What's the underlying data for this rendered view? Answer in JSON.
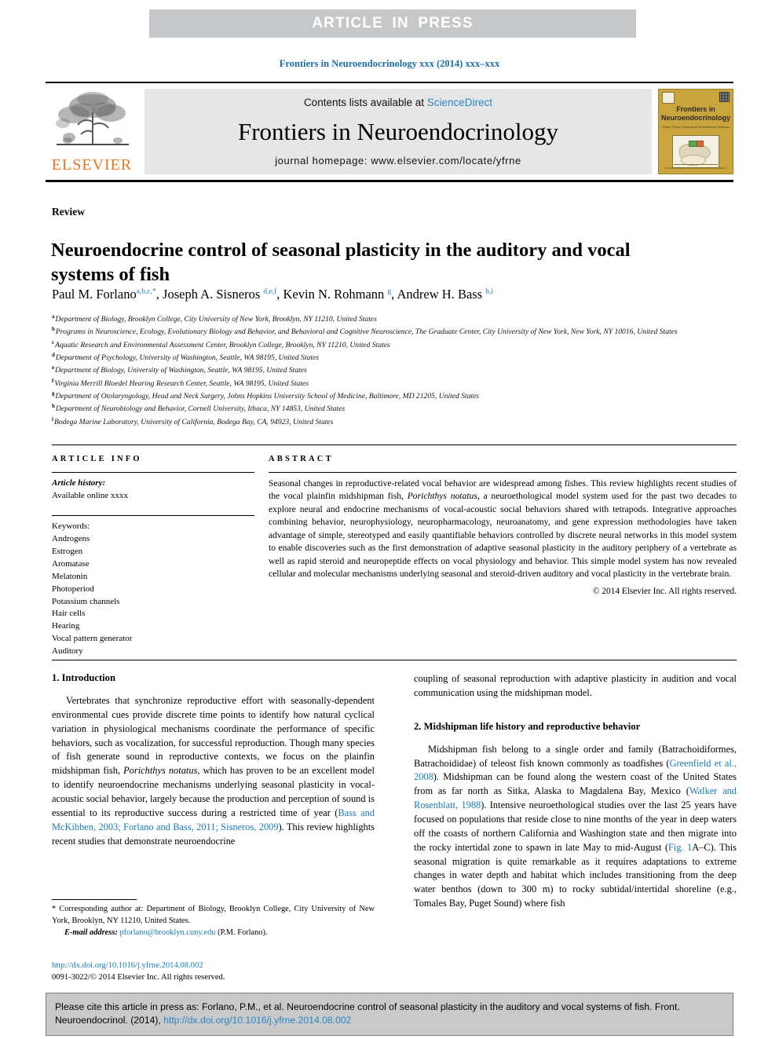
{
  "banner": {
    "text": "ARTICLE IN PRESS",
    "bg_color": "#c6c7c8",
    "text_color": "#ffffff"
  },
  "running_head": "Frontiers in Neuroendocrinology xxx (2014) xxx–xxx",
  "masthead": {
    "publisher_logo_text": "ELSEVIER",
    "publisher_logo_color": "#e87722",
    "contents_prefix": "Contents lists available at ",
    "contents_link": "ScienceDirect",
    "journal_title": "Frontiers in Neuroendocrinology",
    "homepage_line": "journal homepage: www.elsevier.com/locate/yfrne",
    "cover": {
      "title_line1": "Frontiers in",
      "title_line2": "Neuroendocrinology",
      "subtitle": "Volume 35 Issue 2\nInternational Neuroendocrine Federation",
      "bottom_text": "Available online at www.sciencedirect.com\nScienceDirect",
      "bg_color": "#caa43c"
    }
  },
  "article": {
    "type_label": "Review",
    "title": "Neuroendocrine control of seasonal plasticity in the auditory and vocal systems of fish",
    "authors": [
      {
        "name": "Paul M. Forlano",
        "sup": "a,b,c,*"
      },
      {
        "name": "Joseph A. Sisneros",
        "sup": "d,e,f"
      },
      {
        "name": "Kevin N. Rohmann",
        "sup": "g"
      },
      {
        "name": "Andrew H. Bass",
        "sup": "h,i"
      }
    ],
    "affiliations": [
      {
        "marker": "a",
        "text": "Department of Biology, Brooklyn College, City University of New York, Brooklyn, NY 11210, United States"
      },
      {
        "marker": "b",
        "text": "Programs in Neuroscience, Ecology, Evolutionary Biology and Behavior, and Behavioral and Cognitive Neuroscience, The Graduate Center, City University of New York, New York, NY 10016, United States"
      },
      {
        "marker": "c",
        "text": "Aquatic Research and Environmental Assessment Center, Brooklyn College, Brooklyn, NY 11210, United States"
      },
      {
        "marker": "d",
        "text": "Department of Psychology, University of Washington, Seattle, WA 98195, United States"
      },
      {
        "marker": "e",
        "text": "Department of Biology, University of Washington, Seattle, WA 98195, United States"
      },
      {
        "marker": "f",
        "text": "Virginia Merrill Bloedel Hearing Research Center, Seattle, WA 98195, United States"
      },
      {
        "marker": "g",
        "text": "Department of Otolaryngology, Head and Neck Surgery, Johns Hopkins University School of Medicine, Baltimore, MD 21205, United States"
      },
      {
        "marker": "h",
        "text": "Department of Neurobiology and Behavior, Cornell University, Ithaca, NY 14853, United States"
      },
      {
        "marker": "i",
        "text": "Bodega Marine Laboratory, University of California, Bodega Bay, CA, 94923, United States"
      }
    ]
  },
  "article_info": {
    "heading": "ARTICLE INFO",
    "history_label": "Article history:",
    "history_value": "Available online xxxx",
    "keywords_label": "Keywords:",
    "keywords": [
      "Androgens",
      "Estrogen",
      "Aromatase",
      "Melatonin",
      "Photoperiod",
      "Potassium channels",
      "Hair cells",
      "Hearing",
      "Vocal pattern generator",
      "Auditory"
    ]
  },
  "abstract": {
    "heading": "ABSTRACT",
    "part1": "Seasonal changes in reproductive-related vocal behavior are widespread among fishes. This review highlights recent studies of the vocal plainfin midshipman fish, ",
    "species": "Porichthys notatus",
    "part2": ", a neuroethological model system used for the past two decades to explore neural and endocrine mechanisms of vocal-acoustic social behaviors shared with tetrapods. Integrative approaches combining behavior, neurophysiology, neuropharmacology, neuroanatomy, and gene expression methodologies have taken advantage of simple, stereotyped and easily quantifiable behaviors controlled by discrete neural networks in this model system to enable discoveries such as the first demonstration of adaptive seasonal plasticity in the auditory periphery of a vertebrate as well as rapid steroid and neuropeptide effects on vocal physiology and behavior. This simple model system has now revealed cellular and molecular mechanisms underlying seasonal and steroid-driven auditory and vocal plasticity in the vertebrate brain.",
    "copyright": "© 2014 Elsevier Inc. All rights reserved."
  },
  "body": {
    "left": {
      "section1_heading": "1. Introduction",
      "para1_a": "Vertebrates that synchronize reproductive effort with seasonally-dependent environmental cues provide discrete time points to identify how natural cyclical variation in physiological mechanisms coordinate the performance of specific behaviors, such as vocalization, for successful reproduction. Though many species of fish generate sound in reproductive contexts, we focus on the plainfin midshipman fish, ",
      "para1_species": "Porichthys notatus",
      "para1_b": ", which has proven to be an excellent model to identify neuroendocrine mechanisms underlying seasonal plasticity in vocal-acoustic social behavior, largely because the production and perception of sound is essential to its reproductive success during a restricted time of year (",
      "para1_ref": "Bass and McKibben, 2003; Forlano and Bass, 2011; Sisneros, 2009",
      "para1_c": "). This review highlights recent studies that demonstrate neuroendocrine"
    },
    "right": {
      "cont_para": "coupling of seasonal reproduction with adaptive plasticity in audition and vocal communication using the midshipman model.",
      "section2_heading": "2. Midshipman life history and reproductive behavior",
      "para_a": "Midshipman fish belong to a single order and family (Batrachoidiformes, Batrachoididae) of teleost fish known commonly as toadfishes (",
      "ref1": "Greenfield et al., 2008",
      "para_b": "). Midshipman can be found along the western coast of the United States from as far north as Sitka, Alaska to Magdalena Bay, Mexico (",
      "ref2": "Walker and Rosenblatt, 1988",
      "para_c": "). Intensive neuroethological studies over the last 25 years have focused on populations that reside close to nine months of the year in deep waters off the coasts of northern California and Washington state and then migrate into the rocky intertidal zone to spawn in late May to mid-August (",
      "ref3": "Fig. 1",
      "para_d": "A–C). This seasonal migration is quite remarkable as it requires adaptations to extreme changes in water depth and habitat which includes transitioning from the deep water benthos (down to 300 m) to rocky subtidal/intertidal shoreline (e.g., Tomales Bay, Puget Sound) where fish"
    }
  },
  "footnote": {
    "corresponding": "* Corresponding author at: Department of Biology, Brooklyn College, City University of New York, Brooklyn, NY 11210, United States.",
    "email_label": "E-mail address:",
    "email": "pforlano@brooklyn.cuny.edu",
    "email_suffix": "(P.M. Forlano).",
    "doi_url": "http://dx.doi.org/10.1016/j.yfrne.2014.08.002",
    "issn_line": "0091-3022/© 2014 Elsevier Inc. All rights reserved."
  },
  "citation_footer": {
    "prefix": "Please cite this article in press as: Forlano, P.M., et al. Neuroendocrine control of seasonal plasticity in the auditory and vocal systems of fish. Front. Neuroendocrinol. (2014), ",
    "link": "http://dx.doi.org/10.1016/j.yfrne.2014.08.002"
  },
  "colors": {
    "link_blue": "#1a7bb5",
    "elsevier_orange": "#e87722",
    "banner_gray": "#c6c7c8",
    "masthead_gray": "#e6e6e6"
  }
}
